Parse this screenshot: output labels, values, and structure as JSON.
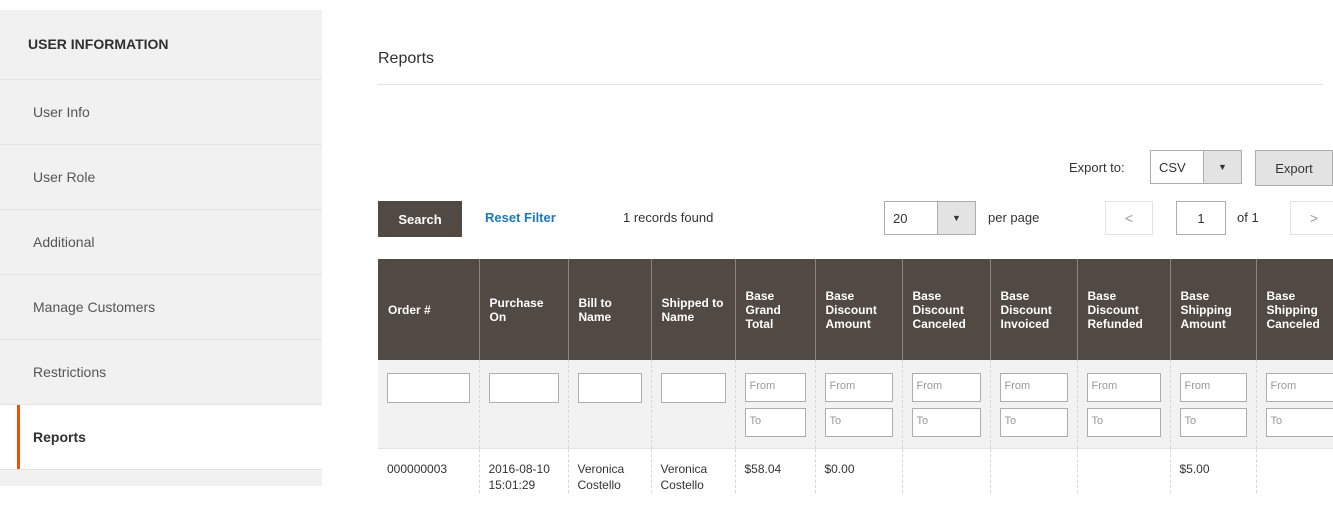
{
  "sidebar": {
    "title": "USER INFORMATION",
    "items": [
      {
        "label": "User Info"
      },
      {
        "label": "User Role"
      },
      {
        "label": "Additional"
      },
      {
        "label": "Manage Customers"
      },
      {
        "label": "Restrictions"
      },
      {
        "label": "Reports"
      }
    ],
    "active_index": 5,
    "accent_color": "#eb5202"
  },
  "main": {
    "title": "Reports",
    "export": {
      "label": "Export to:",
      "format": "CSV",
      "button": "Export"
    },
    "toolbar": {
      "search_button": "Search",
      "reset_filter": "Reset Filter",
      "records_found": "1 records found",
      "per_page_value": "20",
      "per_page_label": "per page",
      "prev": "<",
      "next": ">",
      "current_page": "1",
      "of_pages": "of 1"
    },
    "columns": [
      "Order #",
      "Purchase On",
      "Bill to Name",
      "Shipped to Name",
      "Base Grand Total",
      "Base Discount Amount",
      "Base Discount Canceled",
      "Base Discount Invoiced",
      "Base Discount Refunded",
      "Base Shipping Amount",
      "Base Shipping Canceled"
    ],
    "filter_from": "From",
    "filter_to": "To",
    "rows": [
      [
        "000000003",
        "2016-08-10 15:01:29",
        "Veronica Costello",
        "Veronica Costello",
        "$58.04",
        "$0.00",
        "",
        "",
        "",
        "$5.00",
        ""
      ]
    ]
  }
}
